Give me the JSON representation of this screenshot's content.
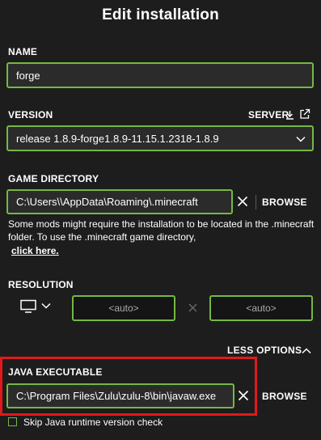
{
  "window": {
    "title": "Edit installation"
  },
  "name_section": {
    "label": "NAME",
    "value": "forge"
  },
  "version_section": {
    "label": "VERSION",
    "server_label": "SERVER",
    "selected": "release 1.8.9-forge1.8.9-11.15.1.2318-1.8.9"
  },
  "game_directory": {
    "label": "GAME DIRECTORY",
    "value": "C:\\Users\\\\AppData\\Roaming\\.minecraft",
    "browse_label": "BROWSE",
    "note": "Some mods might require the installation to be located in the .minecraft folder. To use the .minecraft game directory,",
    "link_text": "click here."
  },
  "resolution": {
    "label": "RESOLUTION",
    "width_value": "<auto>",
    "height_value": "<auto>"
  },
  "options": {
    "toggle_label": "LESS OPTIONS"
  },
  "java_executable": {
    "label": "JAVA EXECUTABLE",
    "value": "C:\\Program Files\\Zulu\\zulu-8\\bin\\javaw.exe",
    "browse_label": "BROWSE"
  },
  "runtime_check": {
    "label": "Skip Java runtime version check",
    "checked": false
  },
  "colors": {
    "background": "#1d1d1d",
    "field_border": "#75b843",
    "highlight": "#e1191b"
  },
  "icons": [
    "download-icon",
    "external-link-icon",
    "chevron-down-icon",
    "clear-icon",
    "monitor-icon",
    "times-icon",
    "chevron-up-icon"
  ]
}
